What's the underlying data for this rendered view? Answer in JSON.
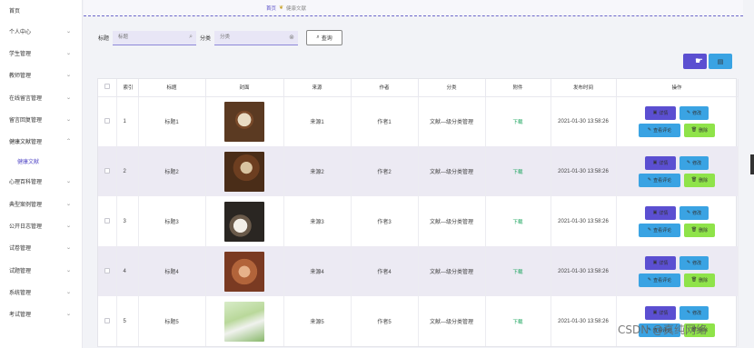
{
  "sidebar": {
    "items": [
      {
        "label": "首页",
        "chevron": false
      },
      {
        "label": "个人中心",
        "chevron": true
      },
      {
        "label": "学生管理",
        "chevron": true
      },
      {
        "label": "教师管理",
        "chevron": true
      },
      {
        "label": "在线留言管理",
        "chevron": true
      },
      {
        "label": "留言回复管理",
        "chevron": true
      },
      {
        "label": "健康文献管理",
        "chevron": true
      },
      {
        "label": "健康文献",
        "sub": true
      },
      {
        "label": "心理百科管理",
        "chevron": true
      },
      {
        "label": "典型案例管理",
        "chevron": true
      },
      {
        "label": "公开日志管理",
        "chevron": true
      },
      {
        "label": "试卷管理",
        "chevron": true
      },
      {
        "label": "试题管理",
        "chevron": true
      },
      {
        "label": "系统管理",
        "chevron": true
      },
      {
        "label": "考试管理",
        "chevron": true
      }
    ]
  },
  "breadcrumb": {
    "home": "首页",
    "separator_icon": "leaf-icon",
    "current": "健康文献"
  },
  "search": {
    "title_label": "标题",
    "title_placeholder": "标题",
    "category_label": "分类",
    "category_placeholder": "分类",
    "query_button": "查询"
  },
  "toolbar": {
    "add_color": "#5b4fd1",
    "delete_color": "#3aa3e3"
  },
  "table": {
    "headers": [
      "",
      "索引",
      "标题",
      "封面",
      "来源",
      "作者",
      "分类",
      "附件",
      "发布时间",
      "操作"
    ],
    "rows": [
      {
        "index": "1",
        "title": "标题1",
        "source": "来源1",
        "author": "作者1",
        "category": "文献—级分类管理",
        "attachment": "下载",
        "time": "2021-01-30 13:58:26"
      },
      {
        "index": "2",
        "title": "标题2",
        "source": "来源2",
        "author": "作者2",
        "category": "文献—级分类管理",
        "attachment": "下载",
        "time": "2021-01-30 13:58:26"
      },
      {
        "index": "3",
        "title": "标题3",
        "source": "来源3",
        "author": "作者3",
        "category": "文献—级分类管理",
        "attachment": "下载",
        "time": "2021-01-30 13:58:26"
      },
      {
        "index": "4",
        "title": "标题4",
        "source": "来源4",
        "author": "作者4",
        "category": "文献—级分类管理",
        "attachment": "下载",
        "time": "2021-01-30 13:58:26"
      },
      {
        "index": "5",
        "title": "标题5",
        "source": "来源5",
        "author": "作者5",
        "category": "文献—级分类管理",
        "attachment": "下载",
        "time": "2021-01-30 13:58:26"
      }
    ],
    "actions": {
      "detail": "详情",
      "edit": "修改",
      "comments": "查看评论",
      "delete": "删除"
    }
  },
  "watermark": "CSDN @真纯网络",
  "colors": {
    "accent": "#5b4fd1",
    "info": "#3aa3e3",
    "success": "#8fe34a",
    "download": "#16a35a"
  }
}
